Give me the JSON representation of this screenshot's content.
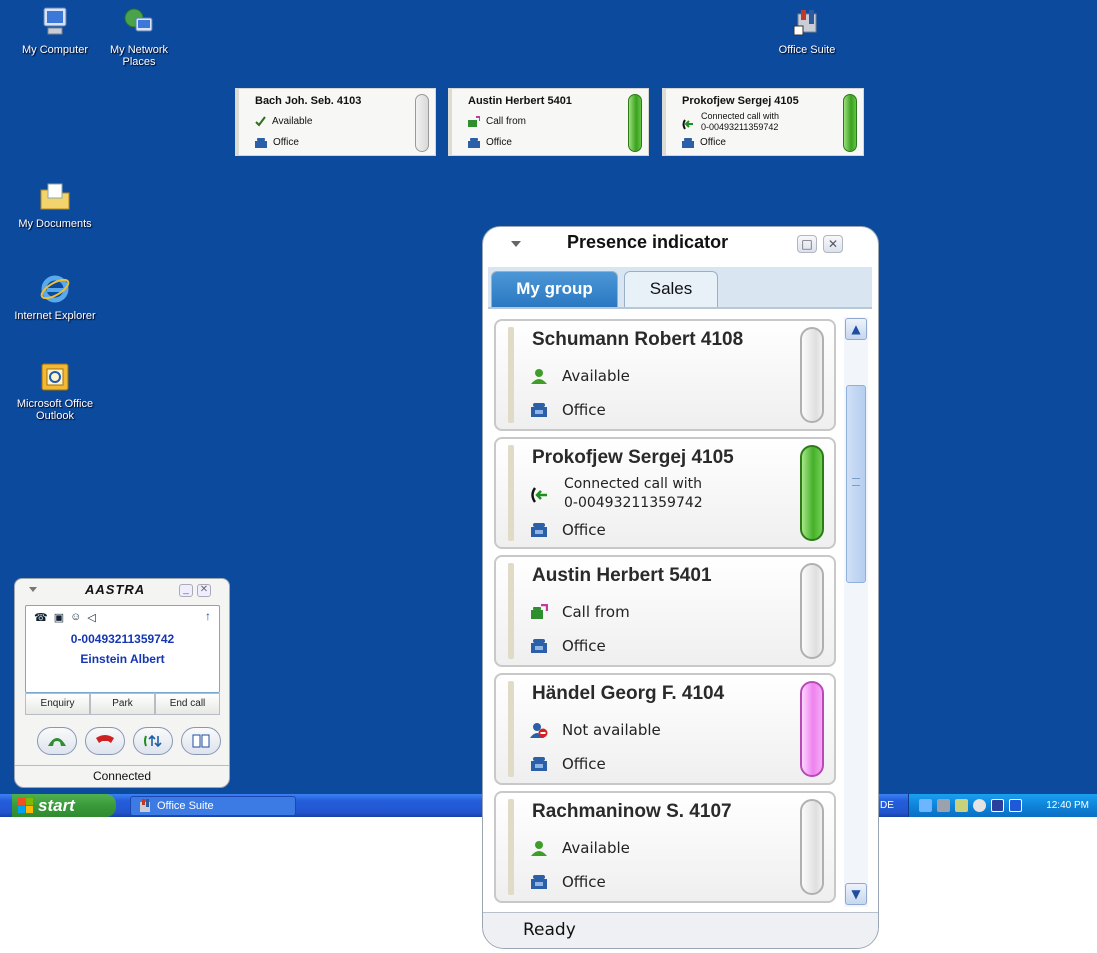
{
  "desktop": {
    "icons": [
      {
        "label": "My Computer",
        "icon": "my-computer-icon"
      },
      {
        "label": "My Network Places",
        "icon": "network-places-icon"
      },
      {
        "label": "Office Suite",
        "icon": "office-suite-icon"
      },
      {
        "label": "My Documents",
        "icon": "my-documents-icon"
      },
      {
        "label": "Internet Explorer",
        "icon": "internet-explorer-icon"
      },
      {
        "label": "Microsoft Office Outlook",
        "icon": "outlook-icon"
      }
    ],
    "background_color": "#0b4a9c"
  },
  "mini_tiles": [
    {
      "name": "Bach Joh. Seb. 4103",
      "status": "Available",
      "location": "Office",
      "state_color": "gray"
    },
    {
      "name": "Austin Herbert 5401",
      "status": "Call from",
      "location": "Office",
      "state_color": "green"
    },
    {
      "name": "Prokofjew Sergej 4105",
      "status": "Connected call with",
      "status_detail": "0-00493211359742",
      "location": "Office",
      "state_color": "green"
    }
  ],
  "phone": {
    "brand": "AASTRA",
    "number": "0-00493211359742",
    "caller": "Einstein Albert",
    "softkeys": [
      "Enquiry",
      "Park",
      "End call"
    ],
    "status": "Connected"
  },
  "presence": {
    "title": "Presence indicator",
    "tabs": [
      {
        "label": "My group",
        "active": true
      },
      {
        "label": "Sales",
        "active": false
      }
    ],
    "contacts": [
      {
        "name": "Schumann Robert 4108",
        "status": "Available",
        "status_detail": "",
        "location": "Office",
        "state_color": "gray",
        "status_icon": "user-available-icon"
      },
      {
        "name": "Prokofjew Sergej 4105",
        "status": "Connected call with",
        "status_detail": "0-00493211359742",
        "location": "Office",
        "state_color": "green",
        "status_icon": "connected-call-icon"
      },
      {
        "name": "Austin Herbert 5401",
        "status": "Call from",
        "status_detail": "",
        "location": "Office",
        "state_color": "gray",
        "status_icon": "incoming-call-icon"
      },
      {
        "name": "Händel Georg F. 4104",
        "status": "Not available",
        "status_detail": "",
        "location": "Office",
        "state_color": "pink",
        "status_icon": "user-not-available-icon"
      },
      {
        "name": "Rachmaninow S. 4107",
        "status": "Available",
        "status_detail": "",
        "location": "Office",
        "state_color": "gray",
        "status_icon": "user-available-icon"
      }
    ],
    "status_bar": "Ready"
  },
  "taskbar": {
    "start_label": "start",
    "task_item": "Office Suite",
    "language": "DE",
    "clock": "12:40 PM"
  }
}
